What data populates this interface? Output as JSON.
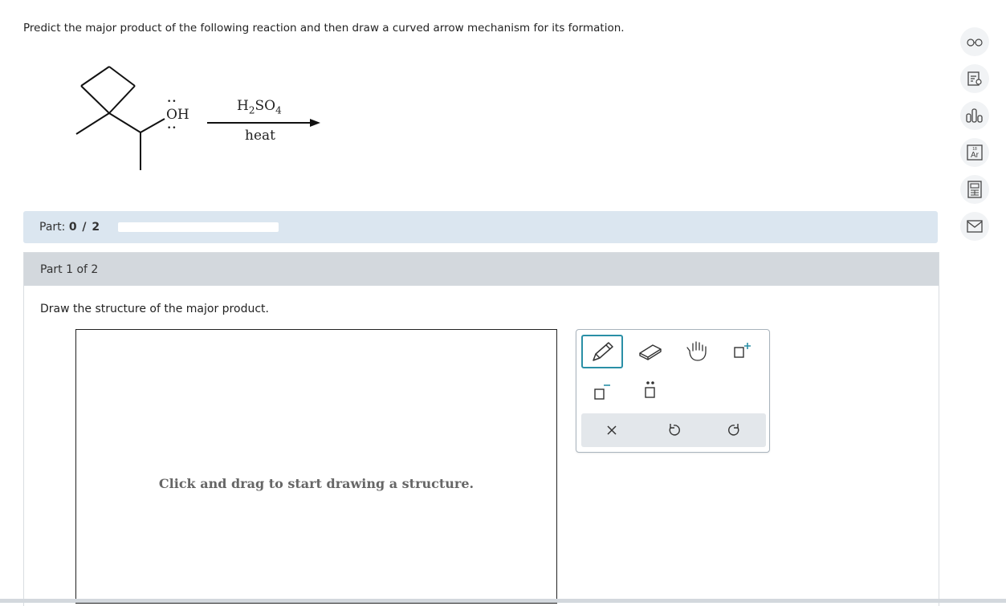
{
  "question": {
    "text": "Predict the major product of the following reaction and then draw a curved arrow mechanism for its formation."
  },
  "reaction": {
    "hydroxyl_label": "OH",
    "reagent_parts": [
      "H",
      "2",
      "SO",
      "4"
    ],
    "condition": "heat"
  },
  "part_bar": {
    "label": "Part:",
    "score": "0 / 2",
    "progress": 0
  },
  "part": {
    "header": "Part 1 of 2",
    "instruction": "Draw the structure of the major product.",
    "canvas_hint": "Click and drag to start drawing a structure."
  },
  "toolbox": {
    "tools": [
      {
        "name": "pencil-tool",
        "selected": true
      },
      {
        "name": "eraser-tool",
        "selected": false
      },
      {
        "name": "hand-tool",
        "selected": false
      },
      {
        "name": "positive-charge-tool",
        "selected": false
      },
      {
        "name": "negative-charge-tool",
        "selected": false
      },
      {
        "name": "lone-pair-tool",
        "selected": false
      }
    ],
    "footer": [
      "clear",
      "undo",
      "redo"
    ]
  },
  "sidebar": {
    "icons": [
      "glasses-icon",
      "review-icon",
      "data-icon",
      "periodic-table-icon",
      "calculator-icon",
      "message-icon"
    ]
  },
  "colors": {
    "accent": "#2a8fa6",
    "part_bar_bg": "#dbe6f0",
    "part_header_bg": "#d3d8dd"
  }
}
